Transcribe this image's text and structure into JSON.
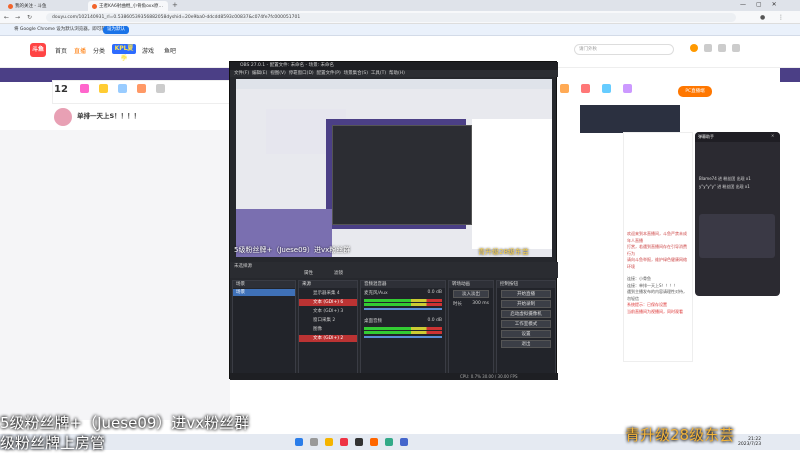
{
  "browser": {
    "tabs": [
      {
        "label": "我的关注 - 斗鱼",
        "active": false
      },
      {
        "label": "王者KA6射曲棍_小骨魚oxx原…",
        "active": true
      }
    ],
    "url": "douyu.com/102140931_rl=0.53860539356882058dyshid=20e9ba0-ddcdd8593c00837&c074fe7fc000051701",
    "infobar_text": "将 Google Chrome 设为默认浏览器，即可获取最佳体验",
    "infobar_button": "设为默认"
  },
  "douyu": {
    "logo": "斗鱼",
    "nav": [
      "首页",
      "直播",
      "分类",
      "游戏",
      "鱼吧"
    ],
    "kpl": "KPL夏季",
    "search_placeholder": "请门外秋",
    "level": "12",
    "room_title": "单排一天上S！！！！",
    "pc_button": "PC直播端"
  },
  "chat": {
    "lines": [
      "欢迎来到本直播间，斗鱼严禁未成年人直播",
      "打赏，若遇到直播间存在引导消费行为",
      "请向斗鱼举报，维护绿色健康网络环境",
      "连接：小骨鱼",
      "连接：单排一天上S！！！！",
      "遇到主播发布的内容请理性对待，勿轻信",
      "系统提示：已保存设置",
      "当前直播间为视播间，同时观看"
    ]
  },
  "popup": {
    "title": "弹幕助手",
    "lines": [
      "Blame74 进 粉丝团 出现 x1",
      "y\"y\"y\"y\" 进 粉丝团 出现 x1"
    ]
  },
  "obs": {
    "title": "OBS 27.0.1 - 配置文件: 未命名 - 场景: 未命名",
    "menu": [
      "文件(F)",
      "编辑(E)",
      "视图(V)",
      "停靠窗口(D)",
      "配置文件(P)",
      "场景集合(S)",
      "工具(T)",
      "帮助(H)"
    ],
    "preview_caption": "5级粉丝牌+（Juese09）进vx粉丝群",
    "preview_caption2": "青升级28级东芸",
    "scene_label": "未选择源",
    "props_btn": "属性",
    "filters_btn": "滤镜",
    "docks": {
      "scenes": {
        "title": "场景",
        "items": [
          "场景"
        ]
      },
      "sources": {
        "title": "来源",
        "items": [
          "显示器采集 4",
          "文本 (GDI+) 6",
          "文本 (GDI+) 3",
          "窗口采集 2",
          "图像",
          "文本 (GDI+) 2"
        ]
      },
      "mixer": {
        "title": "音频混音器",
        "channels": [
          "麦克风/Aux",
          "桌面音频"
        ],
        "levels": [
          "0.0 dB",
          "0.0 dB"
        ]
      },
      "transitions": {
        "title": "转场动画",
        "mode": "淡入淡出",
        "duration_label": "时长",
        "duration": "300 ms"
      },
      "controls": {
        "title": "控制按钮",
        "buttons": [
          "开始直播",
          "开始录制",
          "启动虚拟摄像机",
          "工作室模式",
          "设置",
          "退出"
        ]
      }
    },
    "status": "CPU: 0.7%   30.00 / 30.00 FPS"
  },
  "overlay": {
    "line1": "5级粉丝牌+（Juese09）进vx粉丝群",
    "line2": "级粉丝牌上房管",
    "line3": "青升级28级东芸"
  },
  "taskbar": {
    "time": "21:22",
    "date": "2023/7/23"
  }
}
